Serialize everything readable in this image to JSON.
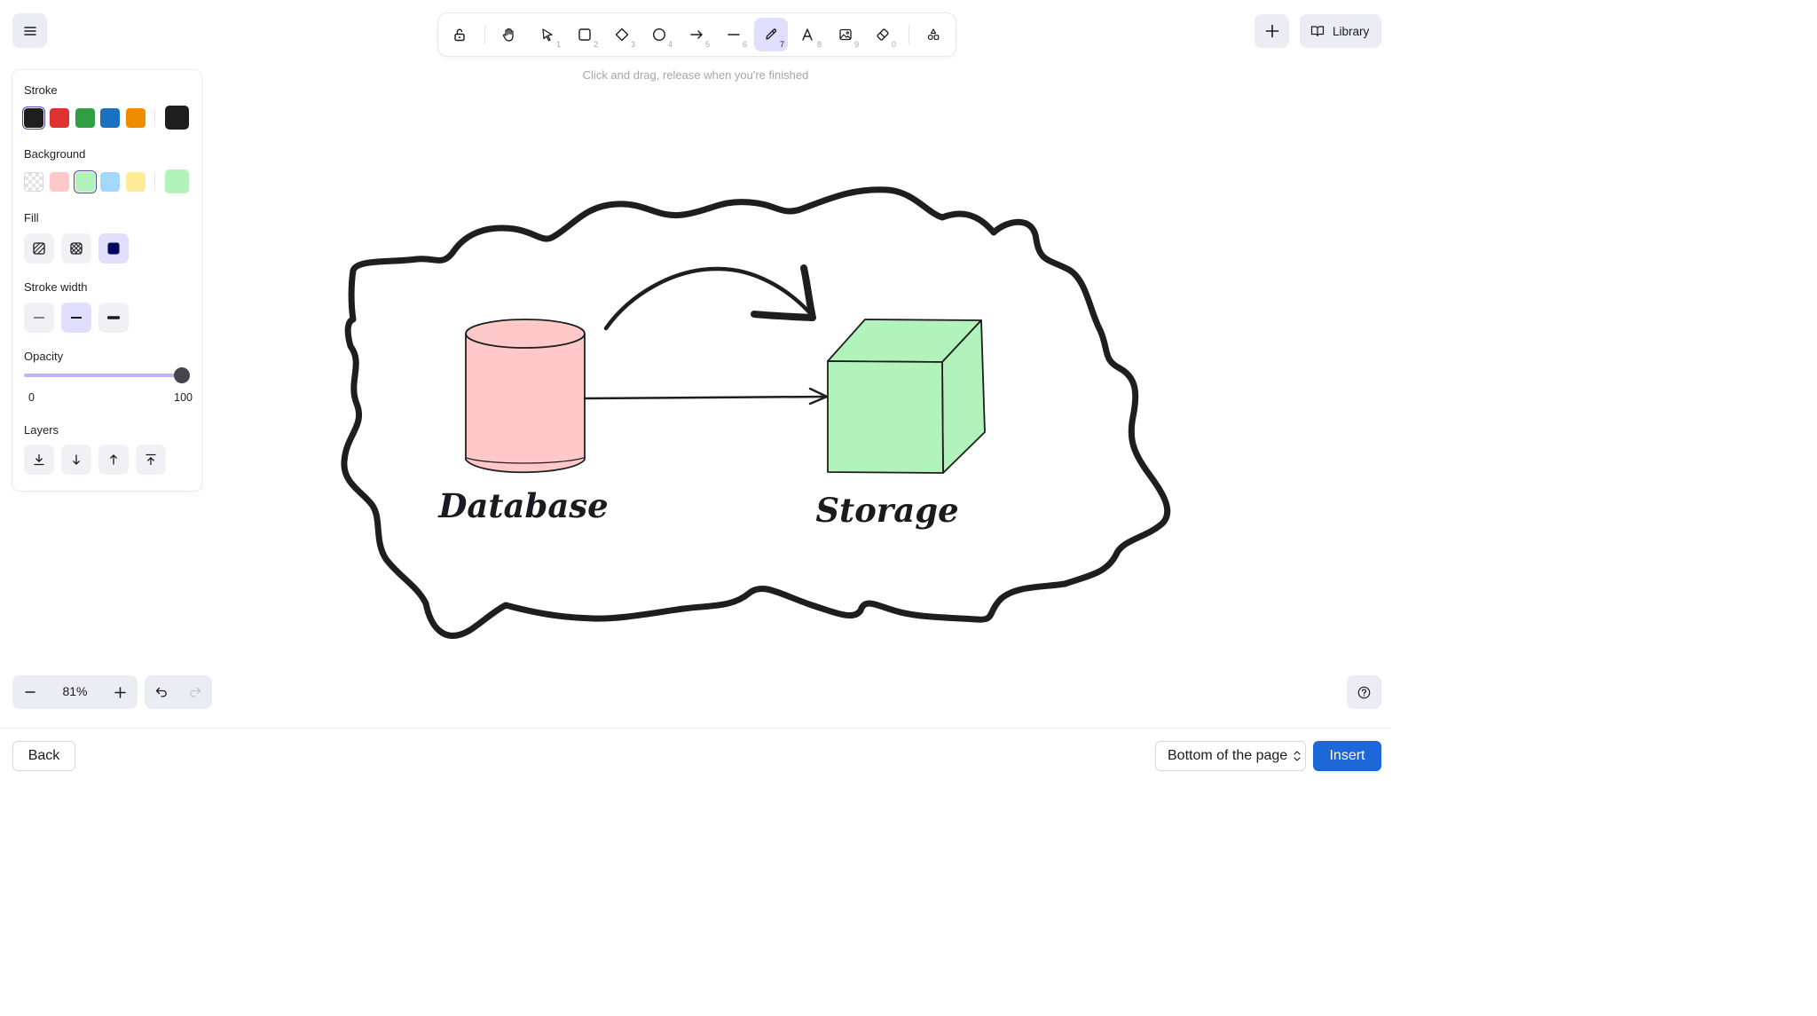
{
  "toolbar": {
    "tools": [
      {
        "name": "lock",
        "num": ""
      },
      {
        "name": "hand",
        "num": ""
      },
      {
        "name": "selection",
        "num": "1"
      },
      {
        "name": "rectangle",
        "num": "2"
      },
      {
        "name": "diamond",
        "num": "3"
      },
      {
        "name": "ellipse",
        "num": "4"
      },
      {
        "name": "arrow",
        "num": "5"
      },
      {
        "name": "line",
        "num": "6"
      },
      {
        "name": "draw",
        "num": "7"
      },
      {
        "name": "text",
        "num": "8"
      },
      {
        "name": "image",
        "num": "9"
      },
      {
        "name": "eraser",
        "num": "0"
      },
      {
        "name": "extra-tools",
        "num": ""
      }
    ],
    "active_tool": "draw",
    "hint": "Click and drag, release when you're finished"
  },
  "top_right": {
    "library_label": "Library"
  },
  "properties": {
    "stroke_label": "Stroke",
    "stroke_colors": [
      "#1e1e1e",
      "#e03131",
      "#2f9e44",
      "#1971c2",
      "#f08c00"
    ],
    "stroke_selected": "#1e1e1e",
    "background_label": "Background",
    "background_colors": [
      "transparent",
      "#ffc9c9",
      "#b2f2bb",
      "#a5d8ff",
      "#ffec99"
    ],
    "background_selected": "#b2f2bb",
    "fill_label": "Fill",
    "fill_options": [
      "hachure",
      "cross-hatch",
      "solid"
    ],
    "fill_selected": "solid",
    "stroke_width_label": "Stroke width",
    "stroke_width_options": [
      "thin",
      "bold",
      "extra-bold"
    ],
    "stroke_width_selected": "bold",
    "opacity_label": "Opacity",
    "opacity_min": "0",
    "opacity_max": "100",
    "opacity_value": 100,
    "layers_label": "Layers"
  },
  "canvas": {
    "labels": {
      "database": "Database",
      "storage": "Storage"
    },
    "colors": {
      "database_fill": "#ffc9c9",
      "storage_fill": "#b2f2bb",
      "stroke": "#1e1e1e"
    }
  },
  "zoom": {
    "level": "81%"
  },
  "footer": {
    "back_label": "Back",
    "position_value": "Bottom of the page",
    "insert_label": "Insert"
  }
}
